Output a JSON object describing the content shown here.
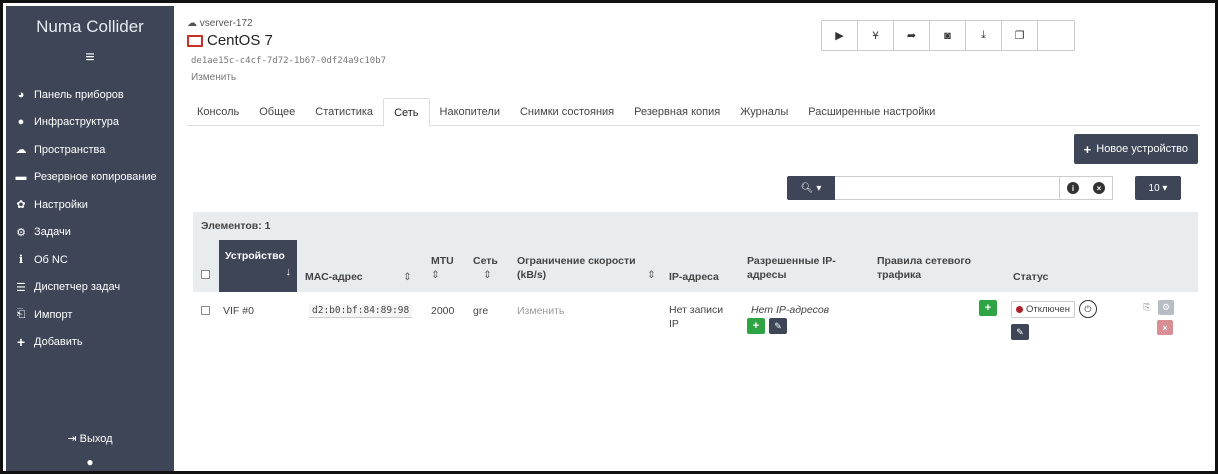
{
  "sidebar": {
    "title": "Numa Collider",
    "menu_icon": "hamburger-icon",
    "items": [
      {
        "label": "Панель приборов",
        "icon": "dashboard-icon"
      },
      {
        "label": "Инфраструктура",
        "icon": "globe-icon"
      },
      {
        "label": "Пространства",
        "icon": "cloud-icon"
      },
      {
        "label": "Резервное копирование",
        "icon": "archive-icon"
      },
      {
        "label": "Настройки",
        "icon": "gear-icon"
      },
      {
        "label": "Задачи",
        "icon": "gears-icon"
      },
      {
        "label": "Об NC",
        "icon": "info-icon"
      },
      {
        "label": "Диспетчер задач",
        "icon": "task-manager-icon"
      },
      {
        "label": "Импорт",
        "icon": "import-icon"
      },
      {
        "label": "Добавить",
        "icon": "plus-icon"
      }
    ],
    "logout_label": "Выход",
    "user_icon": "user-icon"
  },
  "vm": {
    "host": "vserver-172",
    "name": "CentOS 7",
    "uuid": "de1ae15c-c4cf-7d72-1b67-0df24a9c10b7",
    "edit_label": "Изменить"
  },
  "toolbar": {
    "icons": [
      "play-icon",
      "branch-icon",
      "redo-icon",
      "camera-icon",
      "download-icon",
      "copy-icon"
    ]
  },
  "tabs": [
    "Консоль",
    "Общее",
    "Статистика",
    "Сеть",
    "Накопители",
    "Снимки состояния",
    "Резервная копия",
    "Журналы",
    "Расширенные настройки"
  ],
  "active_tab": "Сеть",
  "new_device_label": "Новое устройство",
  "search": {
    "button_label": "▾",
    "value": ""
  },
  "page_size": "10",
  "table": {
    "count_label": "Элементов: 1",
    "headers": {
      "device": "Устройство",
      "mac": "МАС-адрес",
      "mtu": "MTU",
      "network": "Сеть",
      "rate_limit": "Ограничение скорости (kB/s)",
      "ips": "IP-адреса",
      "allowed_ips": "Разрешенные IP-адресы",
      "traffic_rules": "Правила сетевого трафика",
      "status": "Статус"
    },
    "rows": [
      {
        "device": "VIF #0",
        "mac": "d2:b0:bf:84:89:98",
        "mtu": "2000",
        "network": "gre",
        "rate_limit": "Изменить",
        "ips": "Нет записи IP",
        "allowed_ips": "Нет IP-адресов",
        "status": "Отключен"
      }
    ]
  },
  "colors": {
    "sidebar": "#3d4557",
    "success": "#2ea444",
    "danger": "#d9534f",
    "header_bg": "#e9ecef"
  }
}
